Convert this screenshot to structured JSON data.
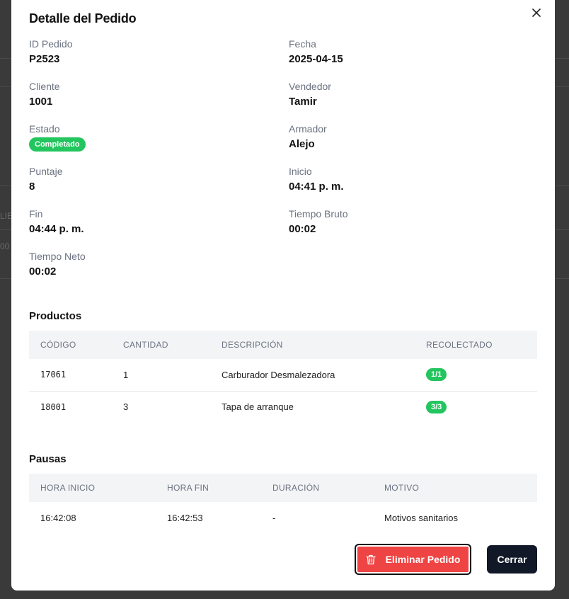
{
  "background": {
    "fragment_1": "LIE",
    "fragment_2": "00"
  },
  "modal": {
    "title": "Detalle del Pedido",
    "fields": {
      "id_pedido": {
        "label": "ID Pedido",
        "value": "P2523"
      },
      "fecha": {
        "label": "Fecha",
        "value": "2025-04-15"
      },
      "cliente": {
        "label": "Cliente",
        "value": "1001"
      },
      "vendedor": {
        "label": "Vendedor",
        "value": "Tamir"
      },
      "estado": {
        "label": "Estado",
        "value": "Completado"
      },
      "armador": {
        "label": "Armador",
        "value": "Alejo"
      },
      "puntaje": {
        "label": "Puntaje",
        "value": "8"
      },
      "inicio": {
        "label": "Inicio",
        "value": "04:41 p. m."
      },
      "fin": {
        "label": "Fin",
        "value": "04:44 p. m."
      },
      "tiempo_bruto": {
        "label": "Tiempo Bruto",
        "value": "00:02"
      },
      "tiempo_neto": {
        "label": "Tiempo Neto",
        "value": "00:02"
      }
    },
    "productos": {
      "title": "Productos",
      "headers": [
        "CÓDIGO",
        "CANTIDAD",
        "DESCRIPCIÓN",
        "RECOLECTADO"
      ],
      "rows": [
        {
          "codigo": "17061",
          "cantidad": "1",
          "descripcion": "Carburador Desmalezadora",
          "recolectado": "1/1"
        },
        {
          "codigo": "18001",
          "cantidad": "3",
          "descripcion": "Tapa de arranque",
          "recolectado": "3/3"
        }
      ]
    },
    "pausas": {
      "title": "Pausas",
      "headers": [
        "HORA INICIO",
        "HORA FIN",
        "DURACIÓN",
        "MOTIVO"
      ],
      "rows": [
        {
          "hora_inicio": "16:42:08",
          "hora_fin": "16:42:53",
          "duracion": "-",
          "motivo": "Motivos sanitarios"
        }
      ]
    },
    "buttons": {
      "delete_label": "Eliminar Pedido",
      "close_label": "Cerrar"
    },
    "colors": {
      "success": "#22c55e",
      "danger": "#ef4444",
      "primary_dark": "#111827"
    },
    "icons": {
      "close": "close-icon",
      "delete": "trash-icon"
    }
  }
}
